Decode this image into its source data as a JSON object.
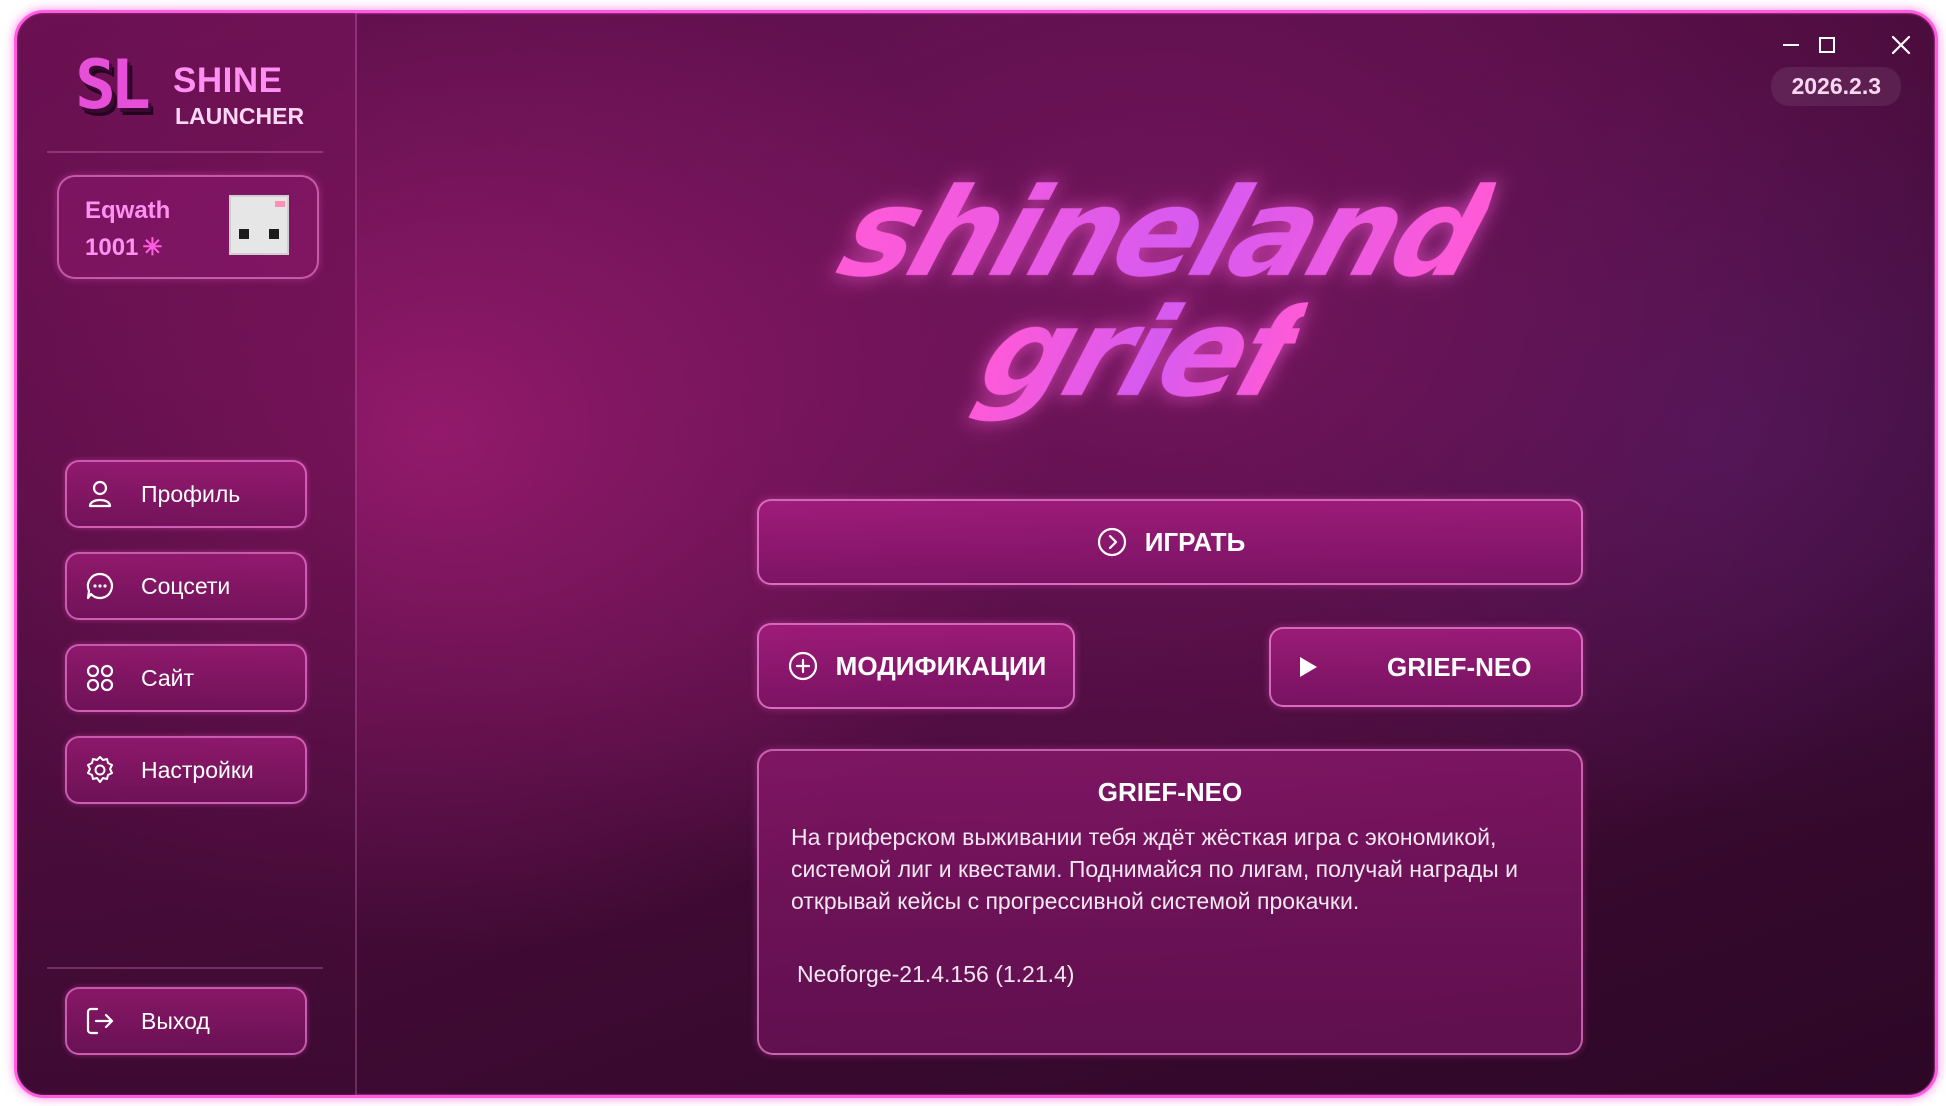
{
  "app": {
    "logo_mark": "SL",
    "title": "SHINE",
    "subtitle": "LAUNCHER",
    "version": "2026.2.3"
  },
  "user": {
    "name": "Eqwath",
    "balance": "1001",
    "currency_icon": "sparkle-icon"
  },
  "nav": {
    "items": [
      {
        "label": "Профиль",
        "icon": "user-icon"
      },
      {
        "label": "Соцсети",
        "icon": "chat-bubble-icon"
      },
      {
        "label": "Сайт",
        "icon": "grid-icon"
      },
      {
        "label": "Настройки",
        "icon": "gear-icon"
      }
    ],
    "logout": {
      "label": "Выход",
      "icon": "logout-icon"
    }
  },
  "hero": {
    "line1": "shineland",
    "line2": "grief"
  },
  "actions": {
    "play_label": "ИГРАТЬ",
    "mods_label": "МОДИФИКАЦИИ",
    "server_label": "GRIEF-NEO"
  },
  "server_info": {
    "title": "GRIEF-NEO",
    "description": "На гриферском выживании тебя ждёт жёсткая игра с экономикой, системой лиг и квестами. Поднимайся по лигам, получай награды и открывай кейсы с прогрессивной системой прокачки.",
    "version": "Neoforge-21.4.156 (1.21.4)"
  },
  "colors": {
    "accent": "#ff5ce0",
    "accent_text": "#ff8ff2",
    "background": "#4a0c3c"
  }
}
